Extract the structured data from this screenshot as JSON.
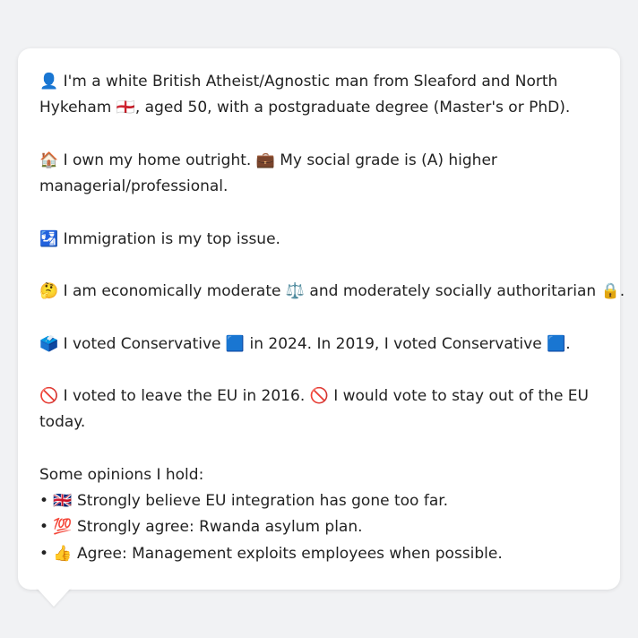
{
  "message": {
    "identity": {
      "line1": "👤 I'm a white British Atheist/Agnostic man from Sleaford and North",
      "line2": "Hykeham 🏴󠁧󠁢󠁥󠁮󠁧󠁿, aged 50, with a postgraduate degree (Master's or PhD)."
    },
    "home": {
      "line1": "🏠 I own my home outright. 💼 My social grade is (A) higher",
      "line2": "managerial/professional."
    },
    "issue": "🛂 Immigration is my top issue.",
    "ideology": "🤔 I am economically moderate ⚖️ and moderately socially authoritarian 🔒.",
    "votes": "🗳️ I voted Conservative 🟦 in 2024. In 2019, I voted Conservative 🟦.",
    "eu": {
      "line1": "🚫 I voted to leave the EU in 2016. 🚫 I would vote to stay out of the EU",
      "line2": "today."
    },
    "opinions_heading": "Some opinions I hold:",
    "opinions": [
      "• 🇬🇧 Strongly believe EU integration has gone too far.",
      "• 💯 Strongly agree: Rwanda asylum plan.",
      "• 👍 Agree: Management exploits employees when possible."
    ]
  }
}
